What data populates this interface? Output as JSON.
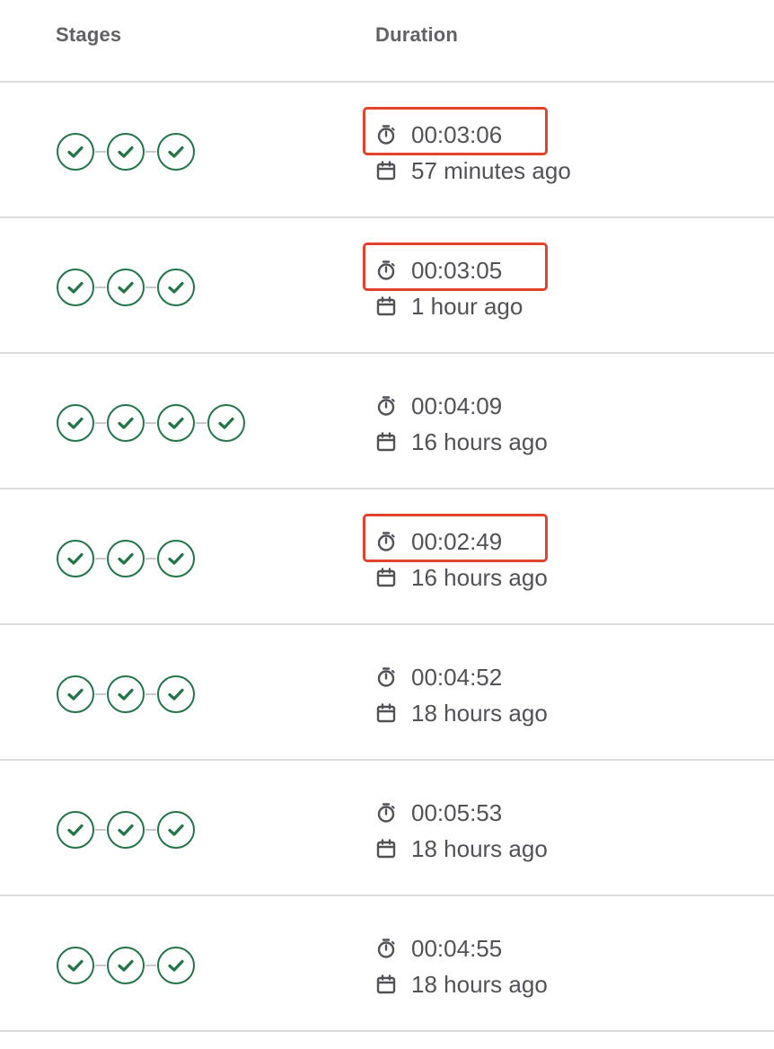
{
  "table": {
    "headers": {
      "stages": "Stages",
      "duration": "Duration"
    },
    "rows": [
      {
        "stages": [
          "passed",
          "passed",
          "passed"
        ],
        "duration": "00:03:06",
        "finished": "57 minutes ago",
        "highlighted": true
      },
      {
        "stages": [
          "passed",
          "passed",
          "passed"
        ],
        "duration": "00:03:05",
        "finished": "1 hour ago",
        "highlighted": true
      },
      {
        "stages": [
          "passed",
          "passed",
          "passed",
          "passed"
        ],
        "duration": "00:04:09",
        "finished": "16 hours ago",
        "highlighted": false
      },
      {
        "stages": [
          "passed",
          "passed",
          "passed"
        ],
        "duration": "00:02:49",
        "finished": "16 hours ago",
        "highlighted": true
      },
      {
        "stages": [
          "passed",
          "passed",
          "passed"
        ],
        "duration": "00:04:52",
        "finished": "18 hours ago",
        "highlighted": false
      },
      {
        "stages": [
          "passed",
          "passed",
          "passed"
        ],
        "duration": "00:05:53",
        "finished": "18 hours ago",
        "highlighted": false
      },
      {
        "stages": [
          "passed",
          "passed",
          "passed"
        ],
        "duration": "00:04:55",
        "finished": "18 hours ago",
        "highlighted": false
      }
    ]
  },
  "icons": {
    "stage_status": "check-circle-icon",
    "duration": "stopwatch-icon",
    "finished": "calendar-icon"
  },
  "colors": {
    "success": "#217645",
    "highlight": "#e0442d",
    "text": "#535158",
    "header_text": "#626168",
    "divider": "#dcdcde"
  }
}
